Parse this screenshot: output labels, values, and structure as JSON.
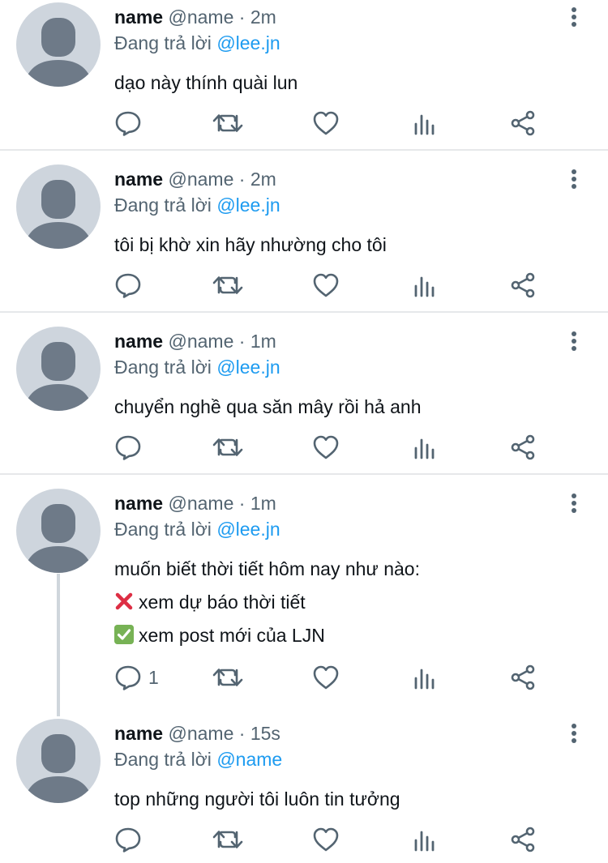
{
  "tweets": [
    {
      "name": "name",
      "handle": "@name",
      "separator": "·",
      "time": "2m",
      "replying_prefix": "Đang trả lời",
      "mention": "@lee.jn",
      "lines": [
        "dạo này thính quài lun"
      ],
      "reply_count": ""
    },
    {
      "name": "name",
      "handle": "@name",
      "separator": "·",
      "time": "2m",
      "replying_prefix": "Đang trả lời",
      "mention": "@lee.jn",
      "lines": [
        "tôi bị khờ xin hãy nhường cho tôi"
      ],
      "reply_count": ""
    },
    {
      "name": "name",
      "handle": "@name",
      "separator": "·",
      "time": "1m",
      "replying_prefix": "Đang trả lời",
      "mention": "@lee.jn",
      "lines": [
        "chuyển nghề qua săn mây rồi hả anh"
      ],
      "reply_count": ""
    },
    {
      "name": "name",
      "handle": "@name",
      "separator": "·",
      "time": "1m",
      "replying_prefix": "Đang trả lời",
      "mention": "@lee.jn",
      "lines": [
        "muốn biết thời tiết hôm nay như nào:",
        "xem dự báo thời tiết",
        "xem post mới của LJN"
      ],
      "reply_count": "1"
    },
    {
      "name": "name",
      "handle": "@name",
      "separator": "·",
      "time": "15s",
      "replying_prefix": "Đang trả lời",
      "mention": "@name",
      "lines": [
        "top những người tôi luôn tin tưởng"
      ],
      "reply_count": ""
    }
  ],
  "icons": {
    "reply": "reply-icon",
    "retweet": "retweet-icon",
    "like": "heart-icon",
    "views": "views-icon",
    "share": "share-icon",
    "more": "more-icon",
    "cross_emoji": "cross-mark-icon",
    "check_emoji": "check-mark-icon"
  },
  "colors": {
    "mention": "#1d9bf0",
    "secondary": "#536471",
    "icon": "#536471",
    "avatar_bg": "#ced5dd",
    "avatar_fg": "#6e7a88"
  }
}
